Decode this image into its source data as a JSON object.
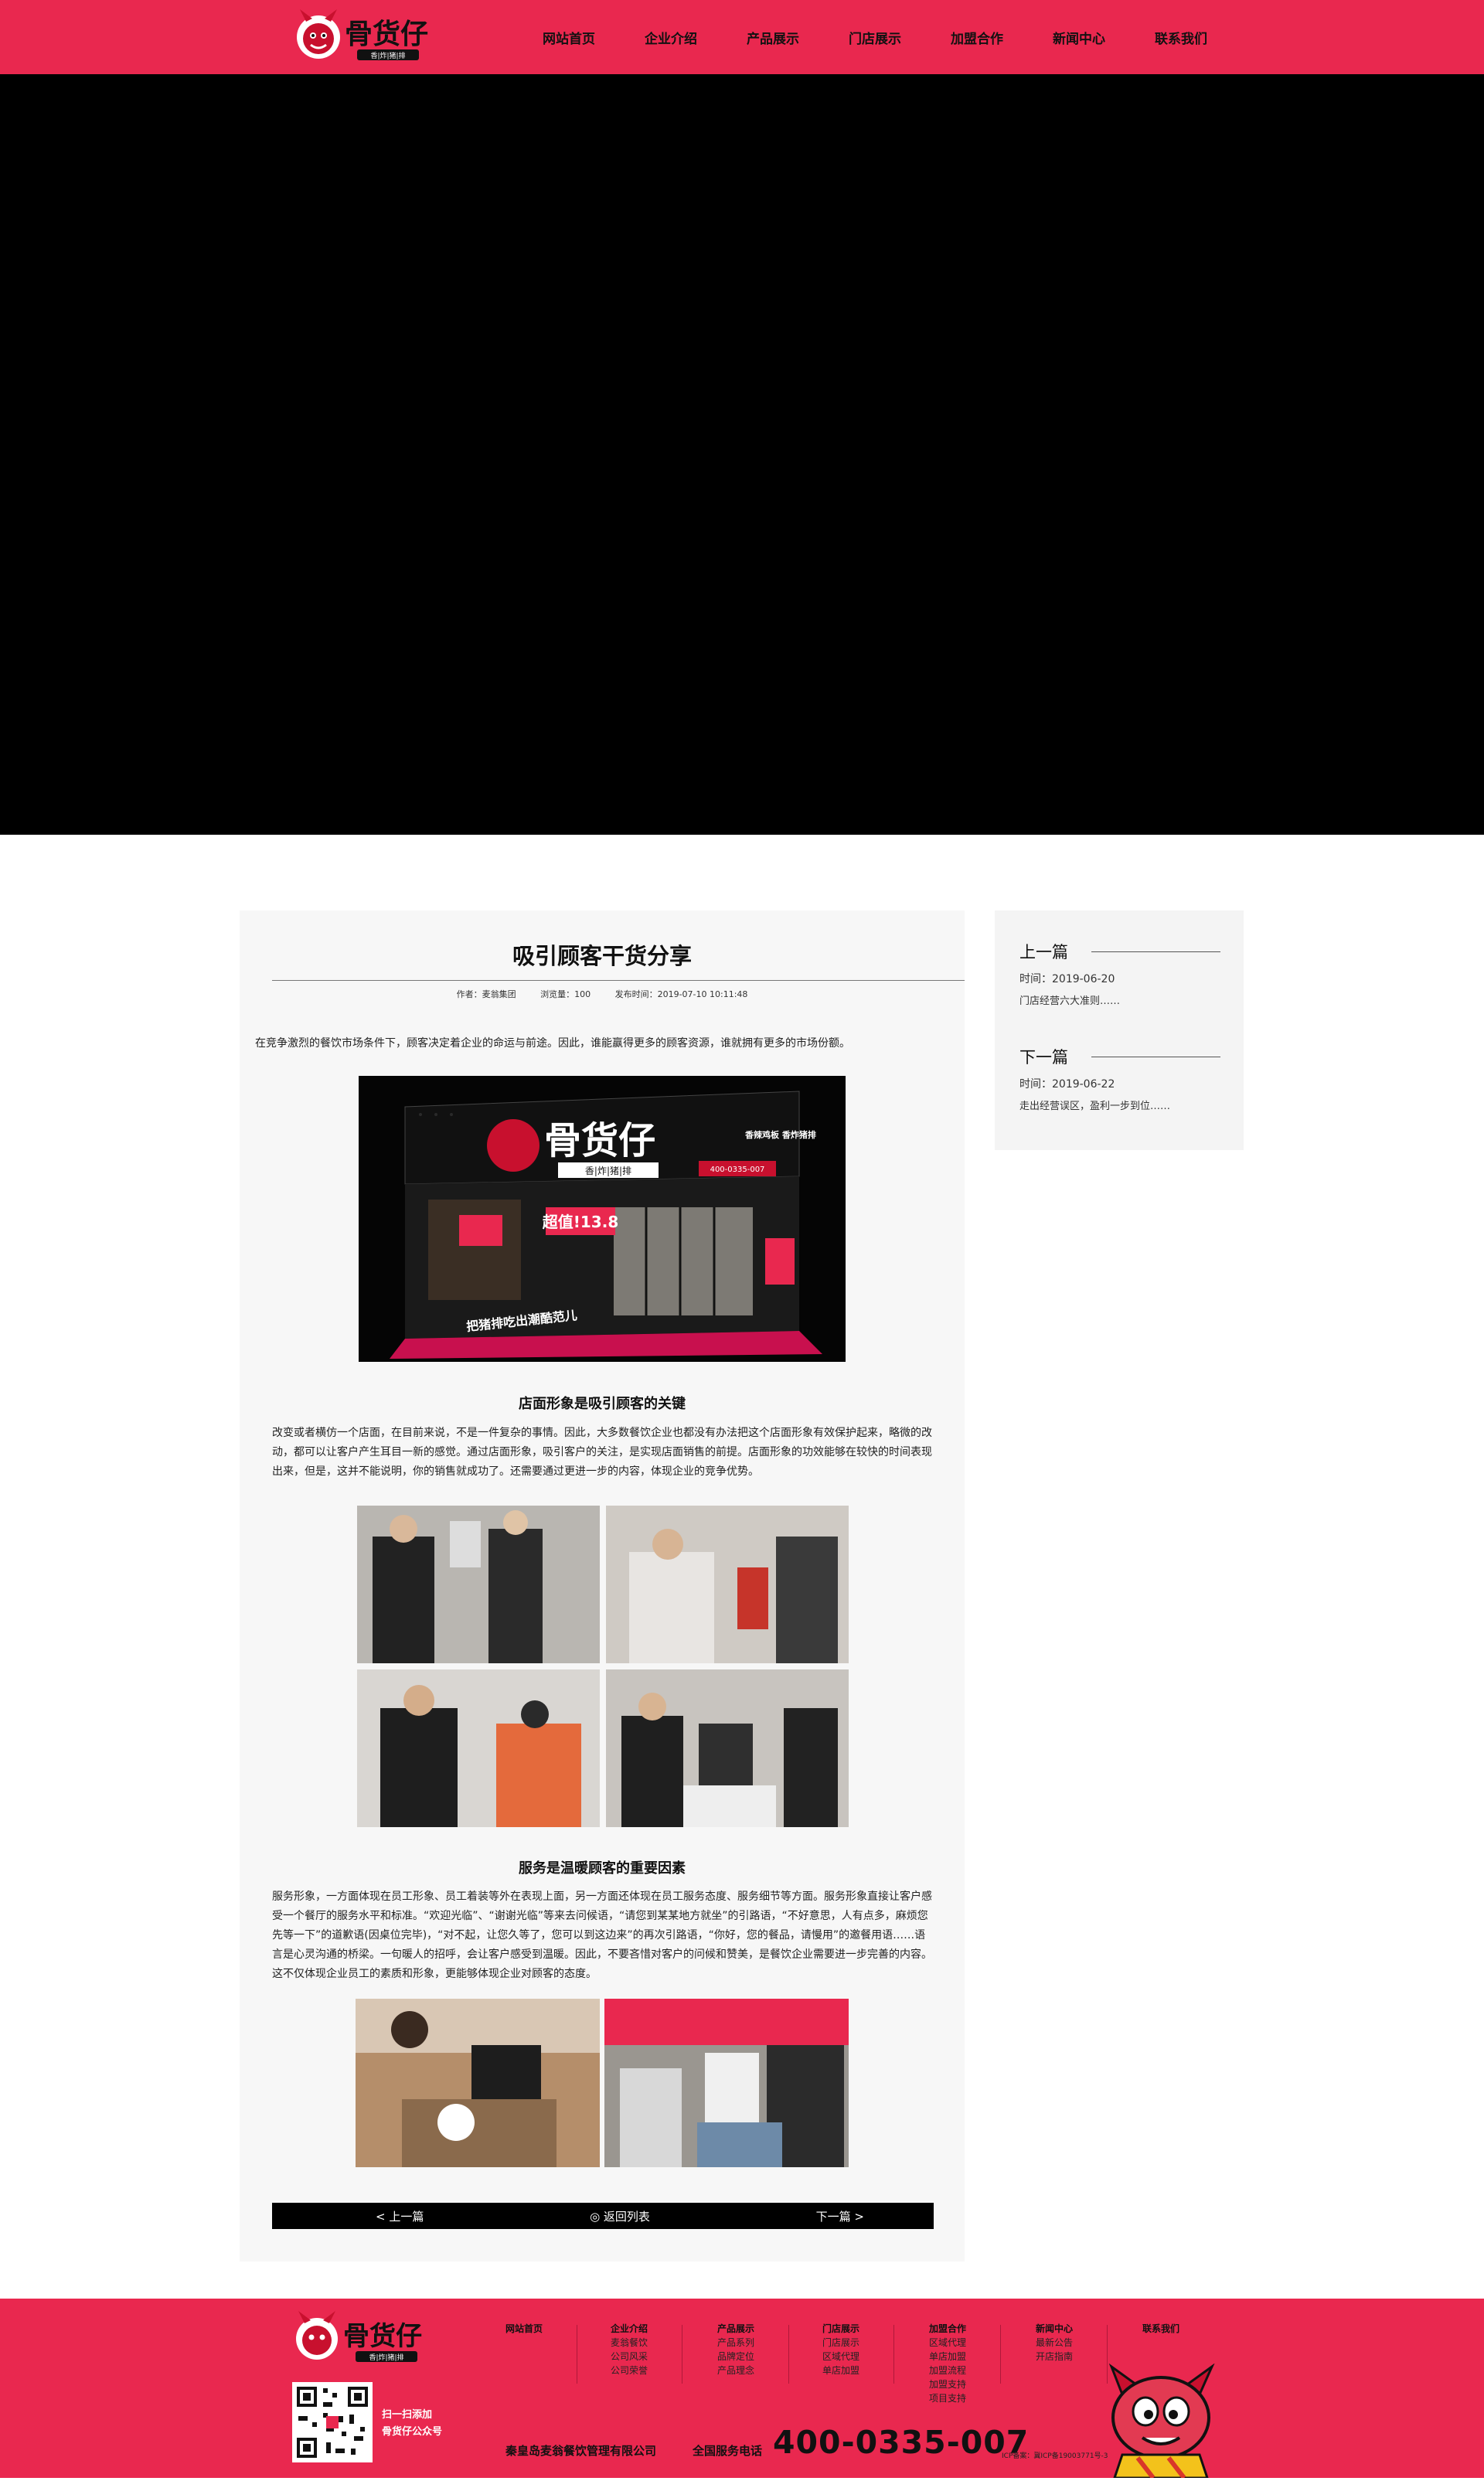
{
  "brand": {
    "name": "骨货仔",
    "tagline": "香|炸|猪|排"
  },
  "nav": [
    "网站首页",
    "企业介绍",
    "产品展示",
    "门店展示",
    "加盟合作",
    "新闻中心",
    "联系我们"
  ],
  "article": {
    "title": "吸引顾客干货分享",
    "author": "作者：麦翁集团",
    "views": "浏览量：100",
    "published": "发布时间：2019-07-10  10:11:48",
    "intro": "在竞争激烈的餐饮市场条件下，顾客决定着企业的命运与前途。因此，谁能赢得更多的顾客资源，谁就拥有更多的市场份额。",
    "section1_title": "店面形象是吸引顾客的关键",
    "section1_body": "改变或者横仿一个店面，在目前来说，不是一件复杂的事情。因此，大多数餐饮企业也都没有办法把这个店面形象有效保护起来，略微的改动，都可以让客户产生耳目一新的感觉。通过店面形象，吸引客户的关注，是实现店面销售的前提。店面形象的功效能够在较快的时间表现出来，但是，这并不能说明，你的销售就成功了。还需要通过更进一步的内容，体现企业的竞争优势。",
    "section2_title": "服务是温暖顾客的重要因素",
    "section2_body": "服务形象，一方面体现在员工形象、员工着装等外在表现上面，另一方面还体现在员工服务态度、服务细节等方面。服务形象直接让客户感受一个餐厅的服务水平和标准。“欢迎光临”、“谢谢光临”等来去问候语，“请您到某某地方就坐”的引路语，“不好意思，人有点多，麻烦您先等一下”的道歉语(因桌位完毕)，“对不起，让您久等了，您可以到这边来”的再次引路语，“你好，您的餐品，请慢用”的邀餐用语……语言是心灵沟通的桥梁。一句暖人的招呼，会让客户感受到温暖。因此，不要吝惜对客户的问候和赞美，是餐饮企业需要进一步完善的内容。这不仅体现企业员工的素质和形象，更能够体现企业对顾客的态度。",
    "storefront": {
      "sign": "骨货仔",
      "sign_sub": "香|炸|猪|排",
      "promo": "超值!13.8",
      "slogan_right": "香辣鸡板 香炸猪排",
      "phone": "400-0335-007",
      "bottom_slogan": "把猪排吃出潮酷范儿"
    },
    "pager": {
      "prev": "< 上一篇",
      "back": "◎ 返回列表",
      "next": "下一篇 >"
    }
  },
  "sidebar": {
    "prev_title": "上一篇",
    "prev_date": "时间：2019-06-20",
    "prev_link": "门店经营六大准则……",
    "next_title": "下一篇",
    "next_date": "时间：2019-06-22",
    "next_link": "走出经营误区，盈利一步到位……"
  },
  "footer": {
    "qr_caption_1": "扫一扫添加",
    "qr_caption_2": "骨货仔公众号",
    "columns": [
      {
        "head": "网站首页",
        "items": []
      },
      {
        "head": "企业介绍",
        "items": [
          "麦翁餐饮",
          "公司风采",
          "公司荣誉"
        ]
      },
      {
        "head": "产品展示",
        "items": [
          "产品系列",
          "品牌定位",
          "产品理念"
        ]
      },
      {
        "head": "门店展示",
        "items": [
          "门店展示",
          "区域代理",
          "单店加盟"
        ]
      },
      {
        "head": "加盟合作",
        "items": [
          "区域代理",
          "单店加盟",
          "加盟流程",
          "加盟支持",
          "项目支持"
        ]
      },
      {
        "head": "新闻中心",
        "items": [
          "最新公告",
          "开店指南"
        ]
      },
      {
        "head": "联系我们",
        "items": []
      }
    ],
    "company": "秦皇岛麦翁餐饮管理有限公司",
    "hotline_label": "全国服务电话",
    "hotline": "400-0335-007",
    "icp": "ICP备案：冀ICP备19003771号-3"
  },
  "colors": {
    "brand_red": "#e9284f",
    "ink": "#111111",
    "panel": "#f7f7f7"
  }
}
